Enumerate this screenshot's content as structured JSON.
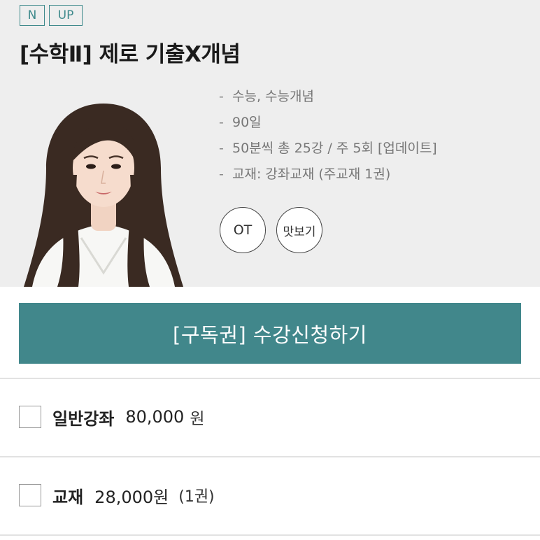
{
  "badges": [
    "N",
    "UP"
  ],
  "course": {
    "title": "[수학Ⅱ] 제로 기출X개념",
    "info": [
      "수능, 수능개념",
      "90일",
      "50분씩 총 25강 / 주 5회 [업데이트]",
      "교재: 강좌교재 (주교재 1권)"
    ],
    "dash": "-"
  },
  "buttons": {
    "ot": "OT",
    "preview": "맛보기",
    "subscribe": "[구독권] 수강신청하기"
  },
  "options": [
    {
      "name": "일반강좌",
      "price": "80,000",
      "unit": "원",
      "qty": ""
    },
    {
      "name": "교재",
      "price": "28,000원",
      "unit": "",
      "qty": "(1권)"
    }
  ],
  "colors": {
    "accent": "#41878b",
    "hero_bg": "#eeeeee",
    "badge": "#3f8a8c"
  }
}
